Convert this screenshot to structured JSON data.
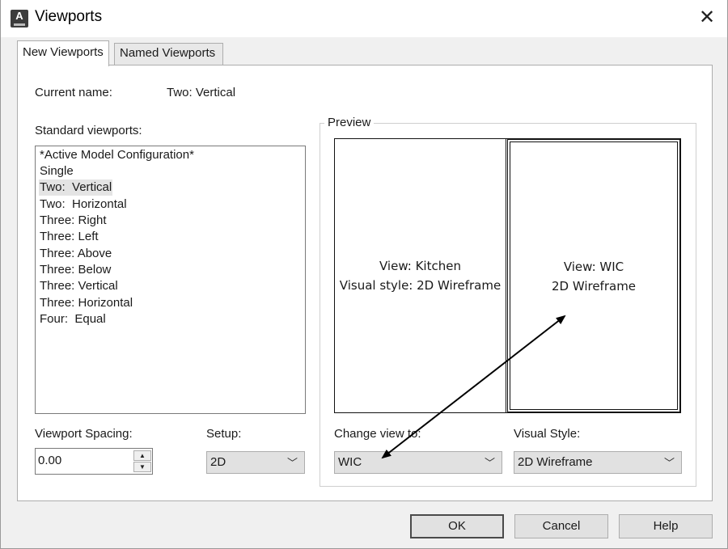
{
  "window": {
    "title": "Viewports",
    "app_icon": "autocad-icon",
    "close_glyph": "✕"
  },
  "tabs": [
    {
      "label": "New Viewports",
      "active": true
    },
    {
      "label": "Named Viewports",
      "active": false
    }
  ],
  "current_name": {
    "label": "Current name:",
    "value": "Two:  Vertical"
  },
  "standard_viewports": {
    "label": "Standard viewports:",
    "items": [
      "*Active Model Configuration*",
      "Single",
      "Two:  Vertical",
      "Two:  Horizontal",
      "Three: Right",
      "Three: Left",
      "Three: Above",
      "Three: Below",
      "Three: Vertical",
      "Three: Horizontal",
      "Four:  Equal"
    ],
    "selected_index": 2
  },
  "preview": {
    "label": "Preview",
    "left_view_line1": "View: Kitchen",
    "left_view_line2": "Visual style: 2D Wireframe",
    "right_view_line1": "View: WIC",
    "right_view_line2": "2D Wireframe"
  },
  "viewport_spacing": {
    "label": "Viewport Spacing:",
    "value": "0.00"
  },
  "setup": {
    "label": "Setup:",
    "value": "2D"
  },
  "change_view_to": {
    "label": "Change view to:",
    "value": "WIC"
  },
  "visual_style": {
    "label": "Visual Style:",
    "value": "2D Wireframe"
  },
  "buttons": {
    "ok": "OK",
    "cancel": "Cancel",
    "help": "Help"
  },
  "colors": {
    "dialog_bg": "#f0f0f0",
    "panel_bg": "#ffffff",
    "selection_bg": "#e4e4e4",
    "annotation_arrow": "#000000"
  }
}
